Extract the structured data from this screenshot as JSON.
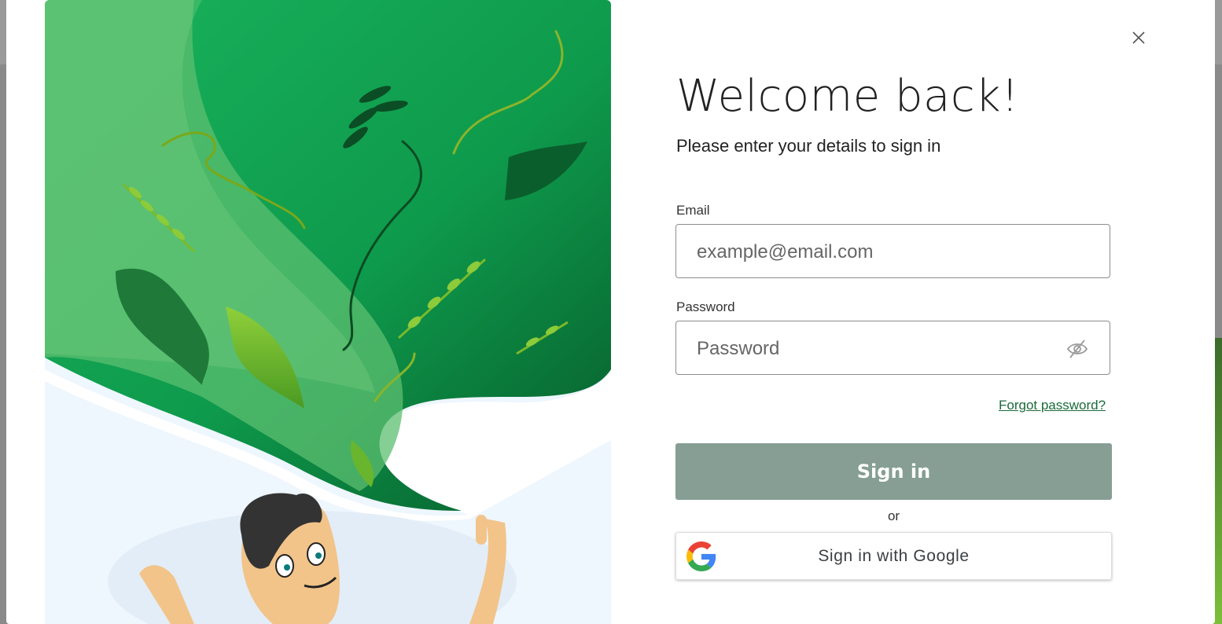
{
  "dialog": {
    "title": "Welcome back!",
    "subtitle": "Please enter your details to sign in"
  },
  "email": {
    "label": "Email",
    "placeholder": "example@email.com",
    "value": ""
  },
  "password": {
    "label": "Password",
    "placeholder": "Password",
    "value": "",
    "toggle_icon": "eye-slash-icon"
  },
  "forgot_password": "Forgot password?",
  "sign_in_button": "Sign in",
  "separator": "or",
  "google_button": {
    "label": "Sign in with Google",
    "icon": "google-logo-icon"
  },
  "colors": {
    "sign_in_button": "#869e94",
    "link": "#1a6b3a",
    "illustration_green": "#14a652"
  }
}
